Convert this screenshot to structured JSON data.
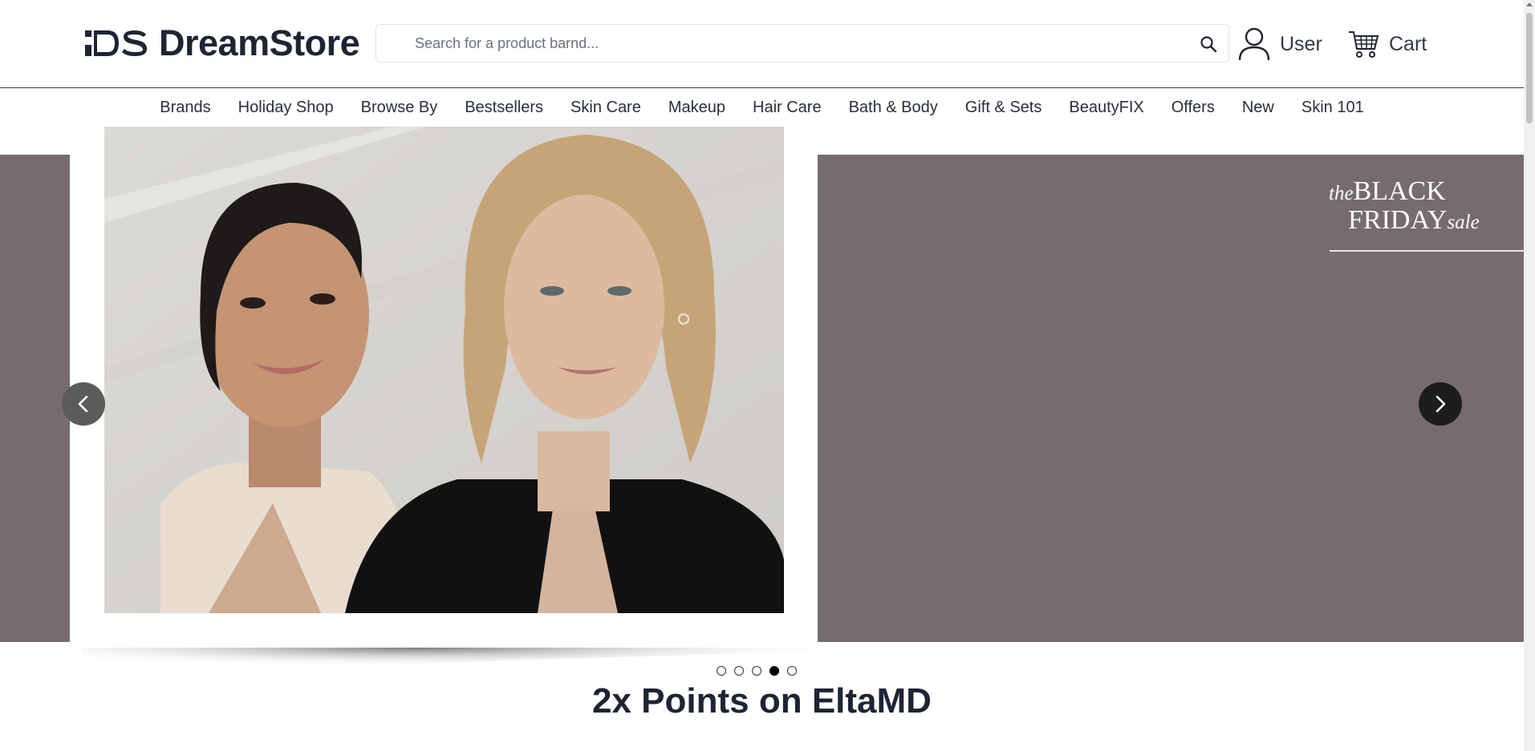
{
  "header": {
    "logo_mark": "DS",
    "logo_text": "DreamStore",
    "search_placeholder": "Search for a product barnd...",
    "user_label": "User",
    "cart_label": "Cart"
  },
  "nav": {
    "items": [
      "Brands",
      "Holiday Shop",
      "Browse By",
      "Bestsellers",
      "Skin Care",
      "Makeup",
      "Hair Care",
      "Bath & Body",
      "Gift & Sets",
      "BeautyFIX",
      "Offers",
      "New",
      "Skin 101"
    ]
  },
  "banner": {
    "badge_the": "the",
    "badge_black": "BLACK",
    "badge_friday": "FRIDAY",
    "badge_sale": "sale",
    "background_color": "#766b70",
    "slide_count": 5,
    "active_slide": 4
  },
  "promo": {
    "title": "2x Points on EltaMD"
  },
  "icons": {
    "search": "search-icon",
    "user": "user-icon",
    "cart": "cart-icon",
    "prev": "chevron-left-icon",
    "next": "chevron-right-icon"
  }
}
